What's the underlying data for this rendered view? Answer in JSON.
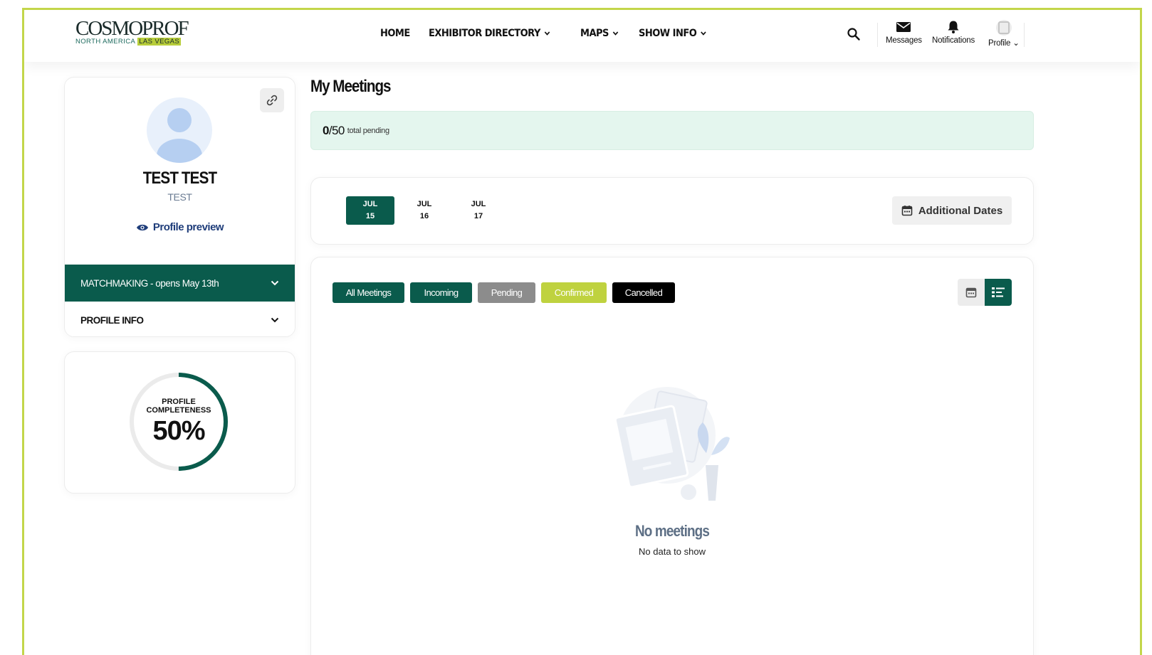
{
  "brand": {
    "name": "COSMOPROF",
    "region": "NORTH AMERICA",
    "city": "LAS VEGAS",
    "accent": "#b7cd3a",
    "primary": "#0a5b4c"
  },
  "nav": {
    "items": [
      {
        "label": "HOME",
        "dropdown": false
      },
      {
        "label": "EXHIBITOR DIRECTORY",
        "dropdown": true
      },
      {
        "label": "MAPS",
        "dropdown": true
      },
      {
        "label": "SHOW INFO",
        "dropdown": true
      }
    ],
    "messages": "Messages",
    "notifications": "Notifications",
    "profile": "Profile"
  },
  "profile": {
    "name": "TEST TEST",
    "subtitle": "TEST",
    "preview_label": "Profile preview",
    "sections": [
      {
        "label": "MATCHMAKING - opens May 13th",
        "active": true
      },
      {
        "label": "PROFILE INFO",
        "active": false
      }
    ],
    "completeness": {
      "label_line1": "PROFILE",
      "label_line2": "COMPLETENESS",
      "value_text": "50%",
      "value": 50
    }
  },
  "meetings": {
    "title": "My Meetings",
    "pending": {
      "count": "0",
      "total": "/50",
      "label": "total pending"
    },
    "dates": [
      {
        "month": "JUL",
        "day": "15",
        "active": true
      },
      {
        "month": "JUL",
        "day": "16",
        "active": false
      },
      {
        "month": "JUL",
        "day": "17",
        "active": false
      }
    ],
    "additional_dates": "Additional Dates",
    "filters": [
      {
        "label": "All Meetings",
        "color": "#0a5b4c"
      },
      {
        "label": "Incoming",
        "color": "#0a5b4c"
      },
      {
        "label": "Pending",
        "color": "#8c8c8c"
      },
      {
        "label": "Confirmed",
        "color": "#bfd23f"
      },
      {
        "label": "Cancelled",
        "color": "#000000"
      }
    ],
    "empty": {
      "title": "No meetings",
      "subtitle": "No data to show"
    }
  }
}
